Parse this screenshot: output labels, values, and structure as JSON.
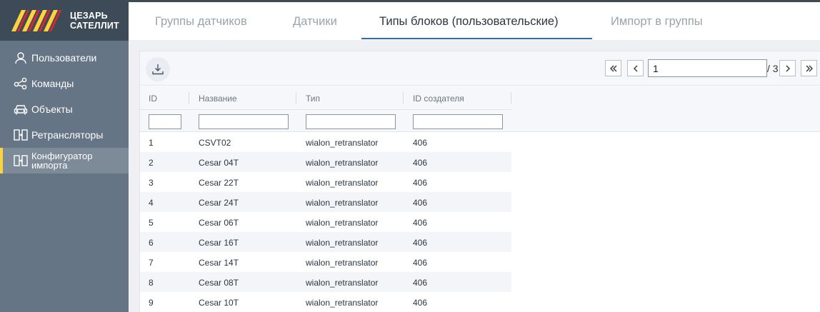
{
  "brand": {
    "line1": "ЦЕЗАРЬ",
    "line2": "САТЕЛЛИТ",
    "stripe_colors": [
      "#ffd23f",
      "#e0262f"
    ]
  },
  "sidebar": {
    "items": [
      {
        "label": "Пользователи",
        "icon": "user-icon"
      },
      {
        "label": "Команды",
        "icon": "share-icon"
      },
      {
        "label": "Объекты",
        "icon": "car-icon"
      },
      {
        "label": "Ретрансляторы",
        "icon": "retranslator-icon"
      },
      {
        "label": "Конфигуратор",
        "label2": "импорта",
        "icon": "retranslator-icon",
        "active": true
      }
    ]
  },
  "tabs": [
    {
      "label": "Группы датчиков"
    },
    {
      "label": "Датчики"
    },
    {
      "label": "Типы блоков (пользовательские)",
      "active": true
    },
    {
      "label": "Импорт в группы"
    }
  ],
  "toolbar": {
    "download_icon": "download-icon"
  },
  "pagination": {
    "current_page": "1",
    "total": "/ 3"
  },
  "table": {
    "columns": [
      "ID",
      "Название",
      "Тип",
      "ID создателя"
    ],
    "rows": [
      [
        "1",
        "CSVT02",
        "wialon_retranslator",
        "406"
      ],
      [
        "2",
        "Cesar 04T",
        "wialon_retranslator",
        "406"
      ],
      [
        "3",
        "Cesar 22T",
        "wialon_retranslator",
        "406"
      ],
      [
        "4",
        "Cesar 24T",
        "wialon_retranslator",
        "406"
      ],
      [
        "5",
        "Cesar 06T",
        "wialon_retranslator",
        "406"
      ],
      [
        "6",
        "Cesar 16T",
        "wialon_retranslator",
        "406"
      ],
      [
        "7",
        "Cesar 14T",
        "wialon_retranslator",
        "406"
      ],
      [
        "8",
        "Cesar 08T",
        "wialon_retranslator",
        "406"
      ],
      [
        "9",
        "Cesar 10T",
        "wialon_retranslator",
        "406"
      ]
    ]
  },
  "colors": {
    "sidebar": "#667585",
    "header_dark": "#3d4a57",
    "active_accent": "#ffd23f",
    "tab_underline": "#2d6cc0"
  }
}
